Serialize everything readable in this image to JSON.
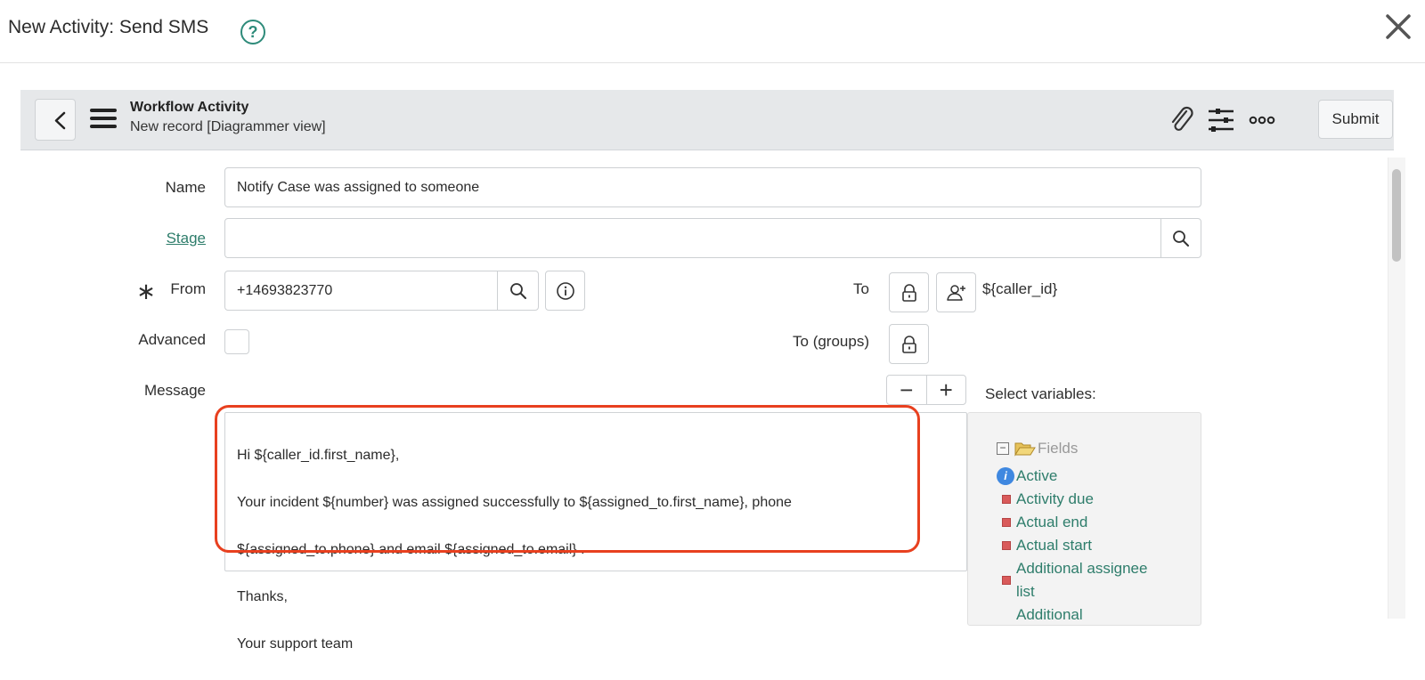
{
  "modal": {
    "title": "New Activity: Send SMS",
    "help_icon": "question-circle-icon",
    "close_icon": "close-x-icon"
  },
  "form_bar": {
    "back_icon": "chevron-left-icon",
    "menu_icon": "hamburger-menu-icon",
    "title": "Workflow Activity",
    "subtitle": "New record [Diagrammer view]",
    "tools": [
      "paperclip-icon",
      "sliders-icon",
      "more-dots-icon"
    ],
    "submit_label": "Submit"
  },
  "form": {
    "name": {
      "label": "Name",
      "value": "Notify Case was assigned to someone"
    },
    "stage": {
      "label": "Stage",
      "value": ""
    },
    "from": {
      "label": "From",
      "required_mark": "∗",
      "value": "+14693823770"
    },
    "to": {
      "label": "To",
      "value": "${caller_id}"
    },
    "to_groups": {
      "label": "To (groups)"
    },
    "advanced": {
      "label": "Advanced",
      "checked": false
    },
    "message": {
      "label": "Message",
      "lines": [
        "Hi ${caller_id.first_name},",
        "Your incident ${number} was assigned successfully to ${assigned_to.first_name}, phone",
        "${assigned_to.phone} and email ${assigned_to.email} .",
        "Thanks,",
        "Your support team"
      ]
    },
    "zoom_minus": "−",
    "zoom_plus": "+"
  },
  "variables": {
    "title": "Select variables:",
    "root": {
      "toggle": "−",
      "label": "Fields"
    },
    "items": [
      {
        "label": "Active",
        "icon": "info"
      },
      {
        "label": "Activity due",
        "icon": "field"
      },
      {
        "label": "Actual end",
        "icon": "field"
      },
      {
        "label": "Actual start",
        "icon": "field"
      },
      {
        "label": "Additional assignee list",
        "icon": "field"
      },
      {
        "label": "Additional",
        "icon": "field"
      }
    ]
  },
  "colors": {
    "accent_green": "#2e7d6b",
    "highlight_red": "#e8401f"
  }
}
